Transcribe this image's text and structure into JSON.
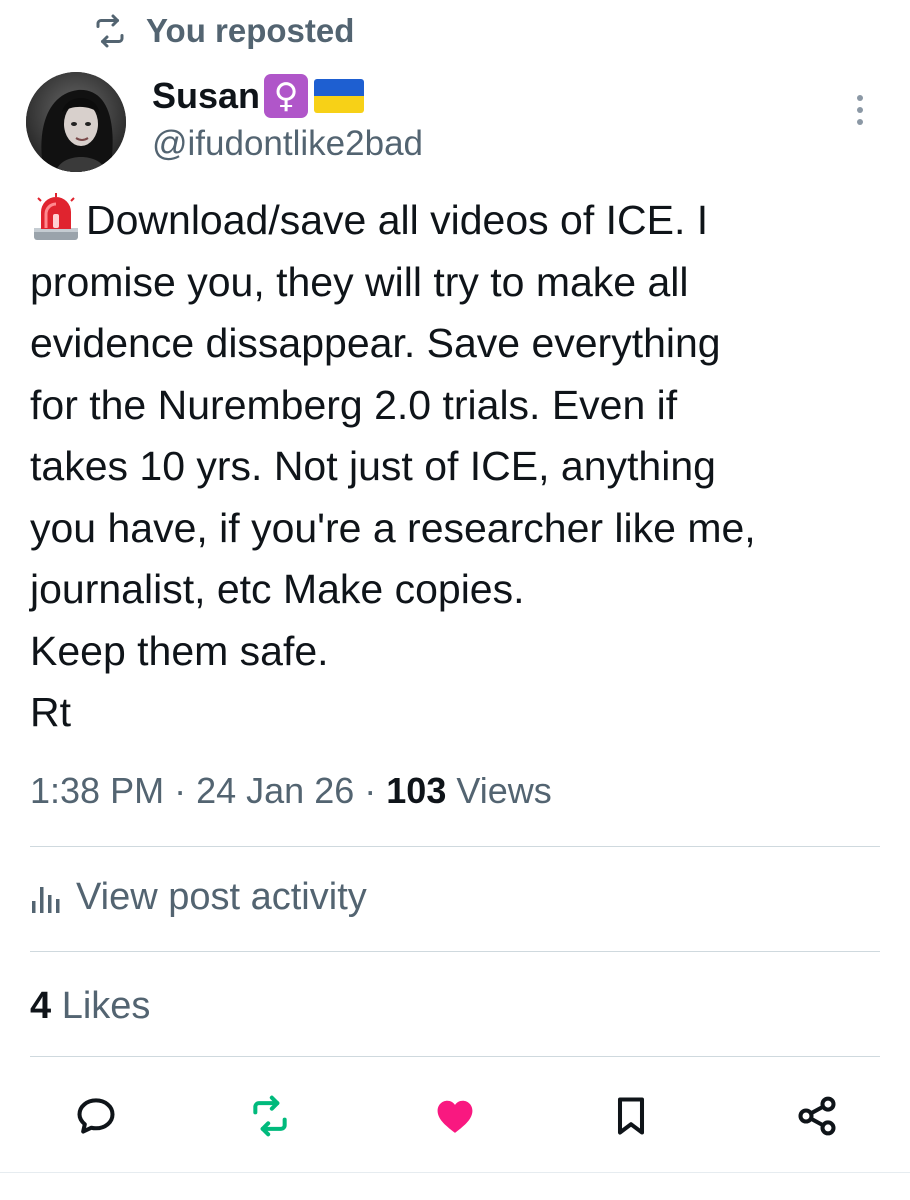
{
  "repost_banner": {
    "text": "You reposted",
    "icon": "repost-icon"
  },
  "author": {
    "name": "Susan",
    "badges": [
      "female-sign-emoji",
      "ukraine-flag-emoji"
    ],
    "venus_symbol": "♀",
    "handle": "@ifudontlike2bad",
    "avatar_icon": "avatar"
  },
  "post": {
    "leading_emoji": "police-siren-emoji",
    "lines": [
      "Download/save all videos of ICE. I",
      "promise you, they will try to make all",
      "evidence dissappear. Save everything",
      "for the Nuremberg 2.0 trials. Even if",
      "takes 10 yrs. Not just of ICE, anything",
      "you have, if you're a researcher like me,",
      "journalist, etc Make copies.",
      "Keep them safe.",
      "Rt"
    ]
  },
  "meta": {
    "time": "1:38 PM",
    "separator": "·",
    "date": "24 Jan 26",
    "views_count": "103",
    "views_label": "Views"
  },
  "activity": {
    "label": "View post activity",
    "icon": "bar-chart-icon"
  },
  "likes": {
    "count": "4",
    "label": "Likes"
  },
  "actions": [
    {
      "name": "reply",
      "icon": "reply-icon"
    },
    {
      "name": "repost",
      "icon": "repost-icon",
      "active": true
    },
    {
      "name": "like",
      "icon": "heart-icon",
      "active": true
    },
    {
      "name": "bookmark",
      "icon": "bookmark-icon"
    },
    {
      "name": "share",
      "icon": "share-icon"
    }
  ],
  "colors": {
    "text_primary": "#0f1419",
    "text_secondary": "#536471",
    "repost_active": "#00ba7c",
    "like_active": "#f91880",
    "divider": "#cfd9de",
    "flag_blue": "#1e5fd1",
    "flag_yellow": "#f7d117",
    "venus_badge": "#b056c9"
  }
}
